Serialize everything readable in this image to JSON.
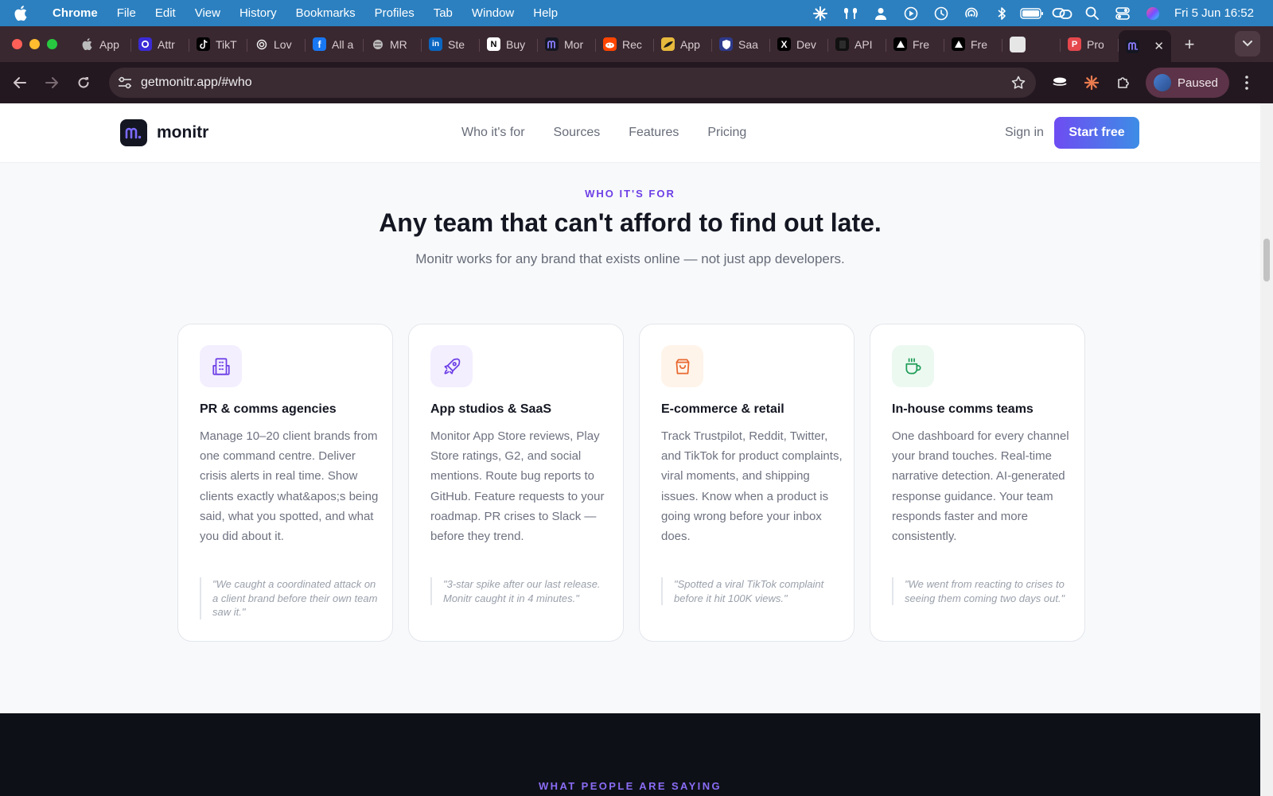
{
  "menubar": {
    "app": "Chrome",
    "items": [
      "File",
      "Edit",
      "View",
      "History",
      "Bookmarks",
      "Profiles",
      "Tab",
      "Window",
      "Help"
    ],
    "clock": "Fri 5 Jun  16:52"
  },
  "tabs": [
    {
      "label": "App",
      "fav": "apple",
      "color": "#3a2830"
    },
    {
      "label": "Attr",
      "fav": "o",
      "color": "#3b2bd6"
    },
    {
      "label": "TikT",
      "fav": "tiktok",
      "color": "#000000"
    },
    {
      "label": "Lov",
      "fav": "spiral",
      "color": "#3a2830"
    },
    {
      "label": "All a",
      "fav": "f",
      "color": "#1877f2"
    },
    {
      "label": "MR",
      "fav": "globe",
      "color": "#3a2830"
    },
    {
      "label": "Ste",
      "fav": "in",
      "color": "#0a66c2"
    },
    {
      "label": "Buy",
      "fav": "N",
      "color": "#ffffff"
    },
    {
      "label": "Mor",
      "fav": "m",
      "color": "#141722"
    },
    {
      "label": "Rec",
      "fav": "reddit",
      "color": "#ff4500"
    },
    {
      "label": "App",
      "fav": "wing",
      "color": "#e7b93c"
    },
    {
      "label": "Saa",
      "fav": "shield",
      "color": "#2d3a8c"
    },
    {
      "label": "Dev",
      "fav": "X",
      "color": "#000000"
    },
    {
      "label": "API",
      "fav": "square",
      "color": "#111111"
    },
    {
      "label": "Fre",
      "fav": "tri",
      "color": "#000000"
    },
    {
      "label": "Fre",
      "fav": "tri",
      "color": "#000000"
    },
    {
      "label": "",
      "fav": "blank",
      "color": "#e6e6e6"
    },
    {
      "label": "Pro",
      "fav": "P",
      "color": "#e5484d"
    }
  ],
  "active_tab": {
    "label": "",
    "fav": "m"
  },
  "toolbar": {
    "url": "getmonitr.app/#who",
    "profile": "Paused"
  },
  "site": {
    "brand": "monitr",
    "nav": [
      "Who it's for",
      "Sources",
      "Features",
      "Pricing"
    ],
    "sign_in": "Sign in",
    "cta": "Start free"
  },
  "section": {
    "eyebrow": "WHO IT'S FOR",
    "title": "Any team that can't afford to find out late.",
    "subtitle": "Monitr works for any brand that exists online — not just app developers."
  },
  "cards": [
    {
      "icon": "building-icon",
      "icon_bg": "#f3efff",
      "icon_color": "#6d3fe6",
      "title": "PR & comms agencies",
      "body": "Manage 10–20 client brands from one command centre. Deliver crisis alerts in real time. Show clients exactly what&apos;s being said, what you spotted, and what you did about it.",
      "quote": "\"We caught a coordinated attack on a client brand before their own team saw it.\""
    },
    {
      "icon": "rocket-icon",
      "icon_bg": "#f3efff",
      "icon_color": "#6d3fe6",
      "title": "App studios & SaaS",
      "body": "Monitor App Store reviews, Play Store ratings, G2, and social mentions. Route bug reports to GitHub. Feature requests to your roadmap. PR crises to Slack — before they trend.",
      "quote": "\"3-star spike after our last release. Monitr caught it in 4 minutes.\""
    },
    {
      "icon": "shopping-bag-icon",
      "icon_bg": "#fff4ea",
      "icon_color": "#e8682f",
      "title": "E-commerce & retail",
      "body": "Track Trustpilot, Reddit, Twitter, and TikTok for product complaints, viral moments, and shipping issues. Know when a product is going wrong before your inbox does.",
      "quote": "\"Spotted a viral TikTok complaint before it hit 100K views.\""
    },
    {
      "icon": "coffee-cup-icon",
      "icon_bg": "#ecf9f1",
      "icon_color": "#1f9d57",
      "title": "In-house comms teams",
      "body": "One dashboard for every channel your brand touches. Real-time narrative detection. AI-generated response guidance. Your team responds faster and more consistently.",
      "quote": "\"We went from reacting to crises to seeing them coming two days out.\""
    }
  ],
  "next_section": {
    "eyebrow": "WHAT PEOPLE ARE SAYING"
  }
}
